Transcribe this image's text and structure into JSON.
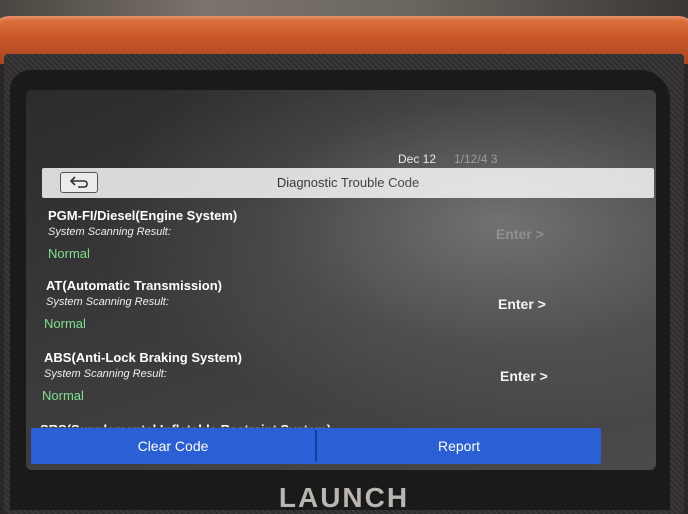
{
  "status_bar": {
    "date": "Dec 12",
    "extra": "1/12/4 3"
  },
  "header": {
    "title": "Diagnostic Trouble Code"
  },
  "systems": [
    {
      "name": "PGM-FI/Diesel(Engine System)",
      "subtitle": "System Scanning Result:",
      "status": "Normal",
      "action": "Enter >"
    },
    {
      "name": "AT(Automatic Transmission)",
      "subtitle": "System Scanning Result:",
      "status": "Normal",
      "action": "Enter >"
    },
    {
      "name": "ABS(Anti-Lock Braking System)",
      "subtitle": "System Scanning Result:",
      "status": "Normal",
      "action": "Enter >"
    }
  ],
  "partial_item": {
    "name": "SRS(Supplemental Inflatable Restraint System)"
  },
  "buttons": {
    "clear": "Clear Code",
    "report": "Report"
  },
  "device": {
    "brand": "LAUNCH"
  },
  "colors": {
    "button_blue": "#2a5fd6",
    "status_green": "#7fe08a",
    "bumper_orange": "#c9582a"
  }
}
